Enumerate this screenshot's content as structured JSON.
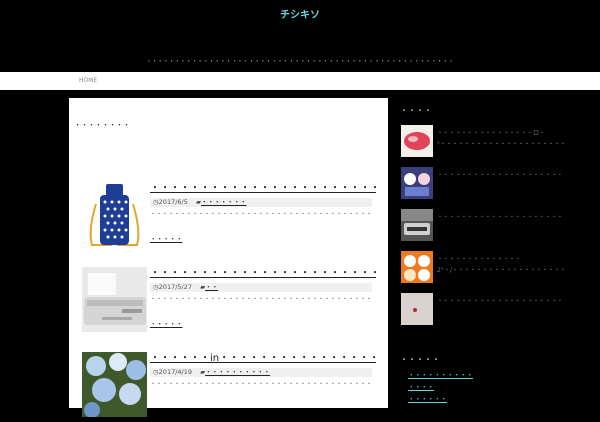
{
  "site": {
    "title": "チシキソ",
    "description": "・・・・・・・・・・・・・・・・・・・・・・・・・・・・・・・・・・・・・・・・・・・・・・・・・・・・・・"
  },
  "nav": {
    "home": "HOME"
  },
  "archive": {
    "title": "・・・・・・・・"
  },
  "posts": [
    {
      "title": "・・・・・・・・・・・・・・・・・・・・・・・・・・・・・・・・・・・",
      "date": "2017/6/5",
      "category": "・・・・・・・",
      "excerpt": "・・・・・・・・・・・・・・・・・・・・・・・・・・・・・・・・・・・・・・・・・・・・・・・・・・・・・・・・・・・・・・・・・・・・・・・・・・・・・・・・・・・・・・・・・・・…",
      "more": "・・・・・"
    },
    {
      "title": "・・・・・・・・・・・・・・・・・・・・・・・・・・・・・・・・・・・・",
      "date": "2017/5/27",
      "category": "・・",
      "excerpt": "・・・・・・・・・・・・・・・・・・・・・・・・・・・・・・・・・・・・・・・・・・・・・・・・・・・・・・・・・・・・・・・・・・・・・・・・・・・・・・・・・・・・・・・・・・・…",
      "more": "・・・・・"
    },
    {
      "title": "・・・・・・in・・・・・・・・・・・・・・・・・・・・・・・2017・",
      "date": "2017/4/19",
      "category": "・・・・・・・・・・",
      "excerpt": "・・・・・・・・・・・・・・・・・・・・・・・・・・・・・・・・・・・・・・・・・・・・・・・・・・・・・・・・・・・・・・・・・・・・・・・・・・・・・・・・・・・・・・・・・・・…",
      "more": ""
    }
  ],
  "sidebar": {
    "popular_heading": "・・・・",
    "popular": [
      {
        "text": "・・・・・・・・・・・・・・・・ロ・°・・・・・・・・・・・・・・・・・・・・・・"
      },
      {
        "text": "・・・・・・・・・・・・・・・・・・・・・・・・・・・・・・・・・・・・・・"
      },
      {
        "text": "・・・・・・・・・・・・・・・・・・・・・・・・・・・・・・・・・・・・・・"
      },
      {
        "text": "・・・・・・・・・・・・・・2°・/・・・・・・・・・・・・・・・・・・・・・・・"
      },
      {
        "text": "・・・・・・・・・・・・・・・・・・・・・・・・・・・・・・・・・・・・・・"
      }
    ],
    "category_heading": "・・・・・",
    "categories": [
      "・・・・・・・・・・",
      "・・・・",
      "・・・・・・"
    ]
  },
  "colors": {
    "accent": "#6fd3de",
    "background": "#000000",
    "content": "#ffffff"
  }
}
